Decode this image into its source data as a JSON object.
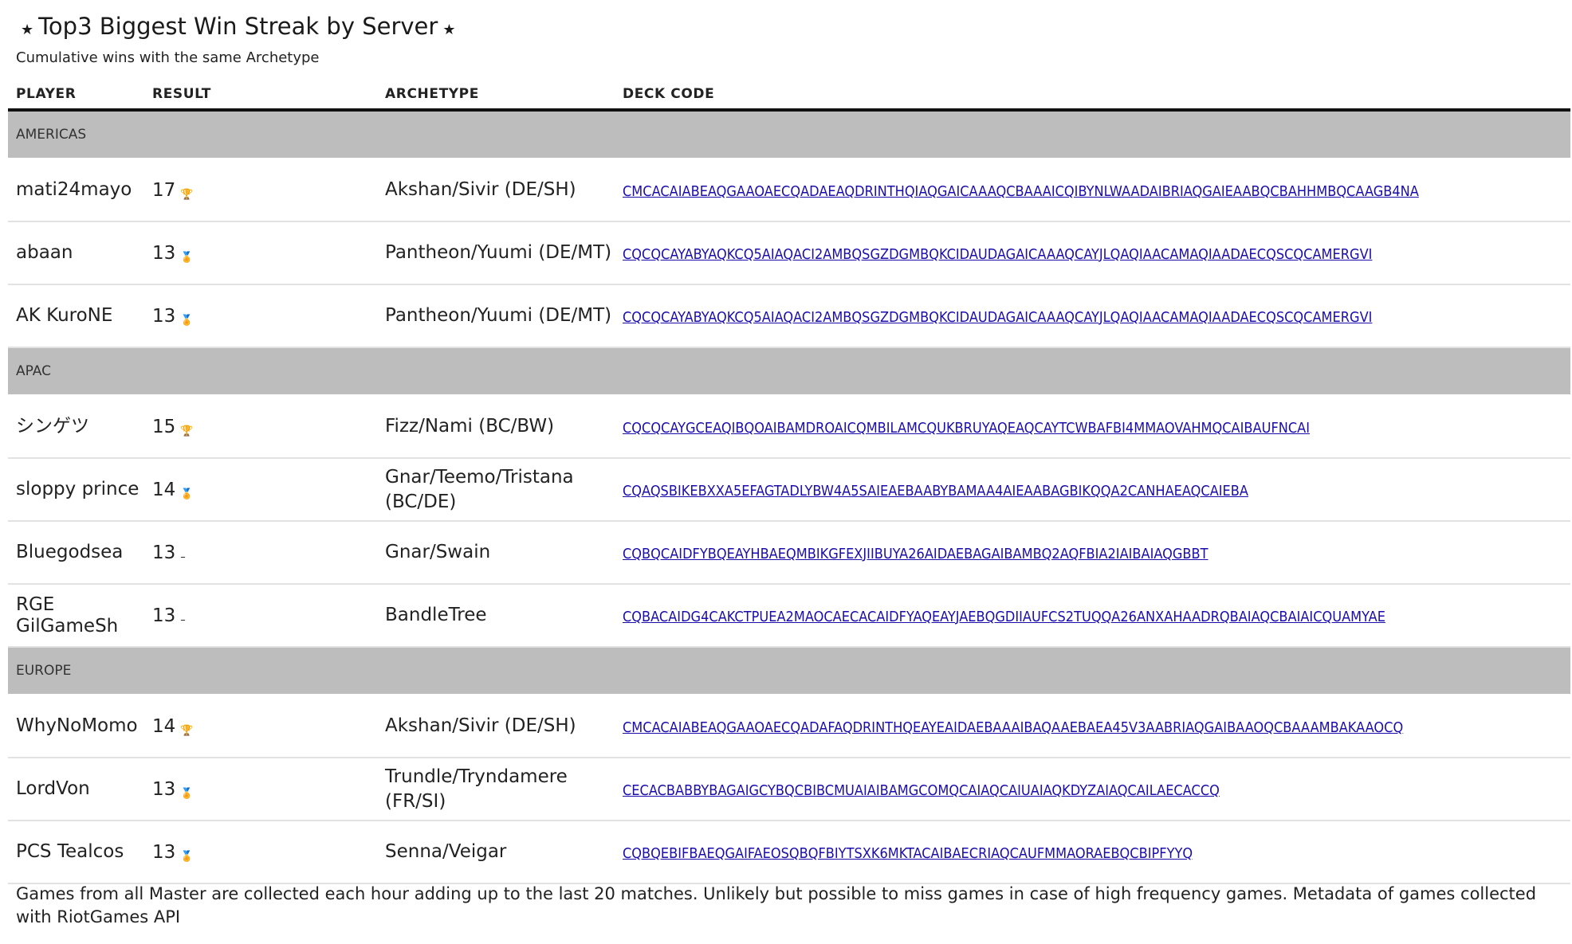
{
  "header": {
    "title": "Top3 Biggest Win Streak by Server",
    "subtitle": "Cumulative wins with the same Archetype"
  },
  "columns": {
    "player": "PLAYER",
    "result": "RESULT",
    "archetype": "ARCHETYPE",
    "deck_code": "DECK CODE"
  },
  "groups": [
    {
      "name": "AMERICAS",
      "rows": [
        {
          "player": "mati24mayo",
          "result": "17",
          "result_icon": "trophy-icon",
          "archetype": "Akshan/Sivir (DE/SH)",
          "deck_code": "CMCACAIABEAQGAAOAECQADAEAQDRINTHQIAQGAICAAAQCBAAAICQIBYNLWAADAIBRIAQGAIEAABQCBAHHMBQCAAGB4NA"
        },
        {
          "player": "abaan",
          "result": "13",
          "result_icon": "medal-icon",
          "archetype": "Pantheon/Yuumi (DE/MT)",
          "deck_code": "CQCQCAYABYAQKCQ5AIAQACI2AMBQSGZDGMBQKCIDAUDAGAICAAAQCAYJLQAQIAACAMAQIAADAECQSCQCAMERGVI"
        },
        {
          "player": "AK KuroNE",
          "result": "13",
          "result_icon": "medal-icon",
          "archetype": "Pantheon/Yuumi (DE/MT)",
          "deck_code": "CQCQCAYABYAQKCQ5AIAQACI2AMBQSGZDGMBQKCIDAUDAGAICAAAQCAYJLQAQIAACAMAQIAADAECQSCQCAMERGVI"
        }
      ]
    },
    {
      "name": "APAC",
      "rows": [
        {
          "player": "シンゲツ",
          "result": "15",
          "result_icon": "trophy-icon",
          "archetype": "Fizz/Nami (BC/BW)",
          "deck_code": "CQCQCAYGCEAQIBQOAIBAMDROAICQMBILAMCQUKBRUYAQEAQCAYTCWBAFBI4MMAOVAHMQCAIBAUFNCAI"
        },
        {
          "player": "sloppy prince",
          "result": "14",
          "result_icon": "medal-icon",
          "archetype": "Gnar/Teemo/Tristana (BC/DE)",
          "deck_code": "CQAQSBIKEBXXA5EFAGTADLYBW4A5SAIEAEBAABYBAMAA4AIEAABAGBIKQQA2CANHAEAQCAIEBA"
        },
        {
          "player": "Bluegodsea",
          "result": "13",
          "result_icon": "dash-icon",
          "archetype": "Gnar/Swain",
          "deck_code": "CQBQCAIDFYBQEAYHBAEQMBIKGFEXJIIBUYA26AIDAEBAGAIBAMBQ2AQFBIA2IAIBAIAQGBBT"
        },
        {
          "player": "RGE GilGameSh",
          "result": "13",
          "result_icon": "dash-icon",
          "archetype": "BandleTree",
          "deck_code": "CQBACAIDG4CAKCTPUEA2MAOCAECACAIDFYAQEAYJAEBQGDIIAUFCS2TUQQA26ANXAHAADRQBAIAQCBAIAICQUAMYAE"
        }
      ]
    },
    {
      "name": "EUROPE",
      "rows": [
        {
          "player": "WhyNoMomo",
          "result": "14",
          "result_icon": "trophy-icon",
          "archetype": "Akshan/Sivir (DE/SH)",
          "deck_code": "CMCACAIABEAQGAAOAECQADAFAQDRINTHQEAYEAIDAEBAAAIBAQAAEBAEA45V3AABRIAQGAIBAAOQCBAAAMBAKAAOCQ"
        },
        {
          "player": "LordVon",
          "result": "13",
          "result_icon": "medal-icon",
          "archetype": "Trundle/Tryndamere (FR/SI)",
          "deck_code": "CECACBABBYBAGAIGCYBQCBIBCMUAIAIBAMGCOMQCAIAQCAIUAIAQKDYZAIAQCAILAECACCQ"
        },
        {
          "player": "PCS Tealcos",
          "result": "13",
          "result_icon": "medal-icon",
          "archetype": "Senna/Veigar",
          "deck_code": "CQBQEBIFBAEQGAIFAEOSQBQFBIYTSXK6MKTACAIBAECRIAQCAUFMMAORAEBQCBIPFYYQ"
        }
      ]
    }
  ],
  "footer": "Games from all Master are collected each hour adding up to the last 20 matches. Unlikely but possible to miss games in case of high frequency games. Metadata of games collected with RiotGames API",
  "icons": {
    "title_star": "star-icon",
    "trophy": "trophy-icon",
    "medal": "medal-icon",
    "dash": "dash-icon"
  },
  "colors": {
    "group_band": "#bdbdbd",
    "link": "#1a0dab",
    "header_rule": "#111111"
  }
}
